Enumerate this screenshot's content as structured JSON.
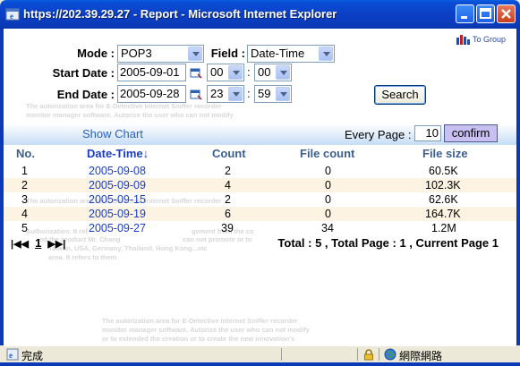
{
  "window": {
    "title": "https://202.39.29.27 - Report - Microsoft Internet Explorer"
  },
  "logo_text": "To Group",
  "form": {
    "mode_label": "Mode :",
    "mode_value": "POP3",
    "field_label": "Field :",
    "field_value": "Date-Time",
    "start_label": "Start Date :",
    "start_date": "2005-09-01",
    "start_hour": "00",
    "start_min": "00",
    "end_label": "End Date :",
    "end_date": "2005-09-28",
    "end_hour": "23",
    "end_min": "59",
    "colon": ":",
    "search_label": "Search"
  },
  "toolbar": {
    "show_chart": "Show Chart",
    "every_page_label": "Every Page :",
    "every_page_value": "10",
    "confirm_label": "confirm"
  },
  "table": {
    "headers": [
      "No.",
      "Date-Time↓",
      "Count",
      "File count",
      "File size"
    ],
    "rows": [
      [
        "1",
        "2005-09-08",
        "2",
        "0",
        "60.5K"
      ],
      [
        "2",
        "2005-09-09",
        "4",
        "0",
        "102.3K"
      ],
      [
        "3",
        "2005-09-15",
        "2",
        "0",
        "62.6K"
      ],
      [
        "4",
        "2005-09-19",
        "6",
        "0",
        "164.7K"
      ],
      [
        "5",
        "2005-09-27",
        "39",
        "34",
        "1.2M"
      ]
    ]
  },
  "pagination": {
    "first": "|◀◀",
    "page": "1",
    "last": "▶▶|",
    "summary": "Total : 5 , Total Page : 1 , Current Page 1"
  },
  "watermark": {
    "line1": "The autorization area for E-Detective Internet Sniffer recorder",
    "line2": "monitor manager software. Autorize the user who can not modify",
    "line3": "or to extended the creation or to create the new innovation's",
    "mid1": "The autorization area for E-Detective Internet Sniffer recorder",
    "left1": "Authorization. It ref",
    "left2": "ed the product Mr. Chang",
    "left3": "Taiwan, USA, Germany, Thailand, Hong Kong...etc",
    "left4": "area. It refers to them",
    "mid2": "gement from the co",
    "mid3": "can not promote or to"
  },
  "status": {
    "text": "完成",
    "zone": "網際網路"
  }
}
